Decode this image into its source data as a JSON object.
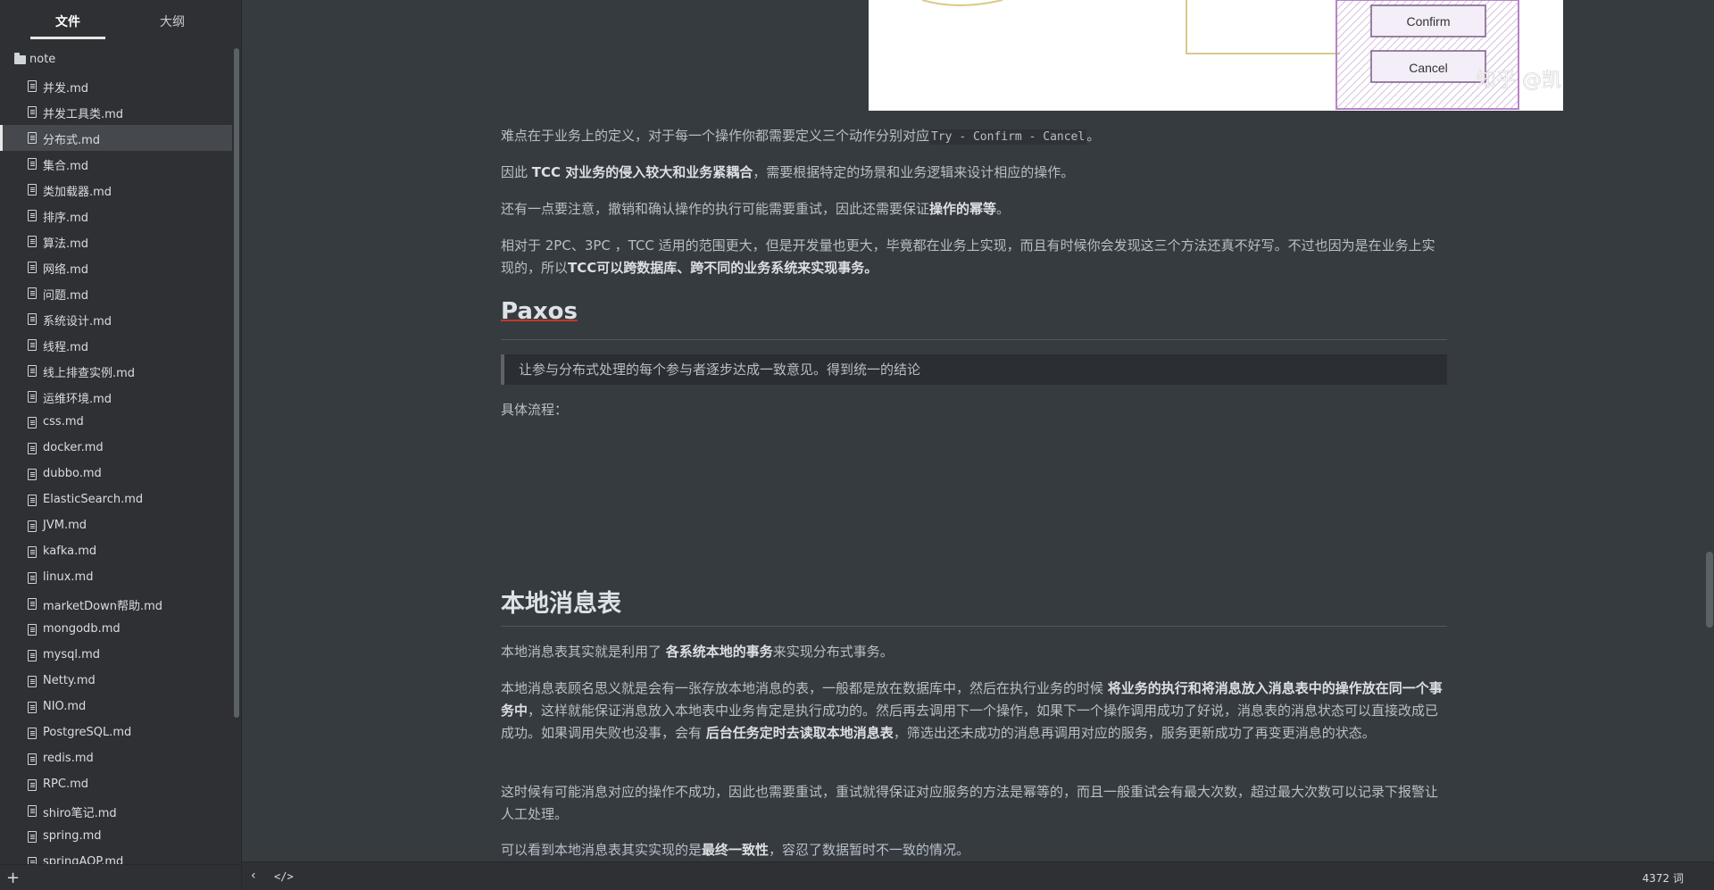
{
  "sidebar": {
    "tabs": [
      "文件",
      "大纲"
    ],
    "folder": "note",
    "files": [
      "并发.md",
      "并发工具类.md",
      "分布式.md",
      "集合.md",
      "类加载器.md",
      "排序.md",
      "算法.md",
      "网络.md",
      "问题.md",
      "系统设计.md",
      "线程.md",
      "线上排查实例.md",
      "运维环境.md",
      "css.md",
      "docker.md",
      "dubbo.md",
      "ElasticSearch.md",
      "JVM.md",
      "kafka.md",
      "linux.md",
      "marketDown帮助.md",
      "mongodb.md",
      "mysql.md",
      "Netty.md",
      "NIO.md",
      "PostgreSQL.md",
      "redis.md",
      "RPC.md",
      "shiro笔记.md",
      "spring.md",
      "springAOP.md"
    ],
    "active_file": "分布式.md",
    "add_icon": "plus-icon"
  },
  "diagram": {
    "confirm_label": "Confirm",
    "cancel_label": "Cancel",
    "watermark": "知乎 @凯"
  },
  "doc": {
    "p1_pre": "难点在于业务上的定义，对于每一个操作你都需要定义三个动作分别对应",
    "p1_code": "Try - Confirm - Cancel",
    "p1_post": "。",
    "p2_pre": "因此 ",
    "p2_bold": "TCC 对业务的侵入较大和业务紧耦合",
    "p2_post": "，需要根据特定的场景和业务逻辑来设计相应的操作。",
    "p3_pre": "还有一点要注意，撤销和确认操作的执行可能需要重试，因此还需要保证",
    "p3_bold": "操作的幂等",
    "p3_post": "。",
    "p4_pre": "相对于 2PC、3PC ，TCC 适用的范围更大，但是开发量也更大，毕竟都在业务上实现，而且有时候你会发现这三个方法还真不好写。不过也因为是在业务上实现的，所以",
    "p4_bold": "TCC可以跨数据库、跨不同的业务系统来实现事务。",
    "h_paxos": "Paxos",
    "quote": "让参与分布式处理的每个参与者逐步达成一致意见。得到统一的结论",
    "flow_label": "具体流程：",
    "h_local": "本地消息表",
    "p5_pre": "本地消息表其实就是利用了 ",
    "p5_bold": "各系统本地的事务",
    "p5_post": "来实现分布式事务。",
    "p6_pre": "本地消息表顾名思义就是会有一张存放本地消息的表，一般都是放在数据库中，然后在执行业务的时候 ",
    "p6_bold": "将业务的执行和将消息放入消息表中的操作放在同一个事务中",
    "p6_mid": "，这样就能保证消息放入本地表中业务肯定是执行成功的。然后再去调用下一个操作，如果下一个操作调用成功了好说，消息表的消息状态可以直接改成已成功。如果调用失败也没事，会有 ",
    "p6_bold2": "后台任务定时去读取本地消息表",
    "p6_post": "，筛选出还未成功的消息再调用对应的服务，服务更新成功了再变更消息的状态。",
    "p7": "这时候有可能消息对应的操作不成功，因此也需要重试，重试就得保证对应服务的方法是幂等的，而且一般重试会有最大次数，超过最大次数可以记录下报警让人工处理。",
    "p8_pre": "可以看到本地消息表其实实现的是",
    "p8_bold": "最终一致性",
    "p8_post": "，容忍了数据暂时不一致的情况。"
  },
  "footer": {
    "back_icon": "chevron-left-icon",
    "source_icon": "code-icon",
    "word_count": "4372 词"
  }
}
